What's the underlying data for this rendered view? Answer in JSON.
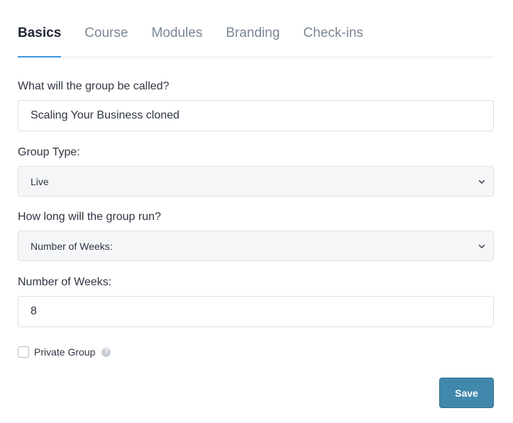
{
  "tabs": [
    {
      "label": "Basics",
      "active": true
    },
    {
      "label": "Course",
      "active": false
    },
    {
      "label": "Modules",
      "active": false
    },
    {
      "label": "Branding",
      "active": false
    },
    {
      "label": "Check-ins",
      "active": false
    }
  ],
  "form": {
    "name_label": "What will the group be called?",
    "name_value": "Scaling Your Business cloned",
    "type_label": "Group Type:",
    "type_value": "Live",
    "duration_label": "How long will the group run?",
    "duration_value": "Number of Weeks:",
    "weeks_label": "Number of Weeks:",
    "weeks_value": "8",
    "private_label": "Private Group",
    "private_checked": false,
    "help_icon": "question-circle-icon",
    "chevron_icon": "chevron-down-icon"
  },
  "actions": {
    "save_label": "Save"
  },
  "colors": {
    "accent": "#3b99d9",
    "save_button": "#4189ac",
    "select_background": "#f5f6f8"
  }
}
